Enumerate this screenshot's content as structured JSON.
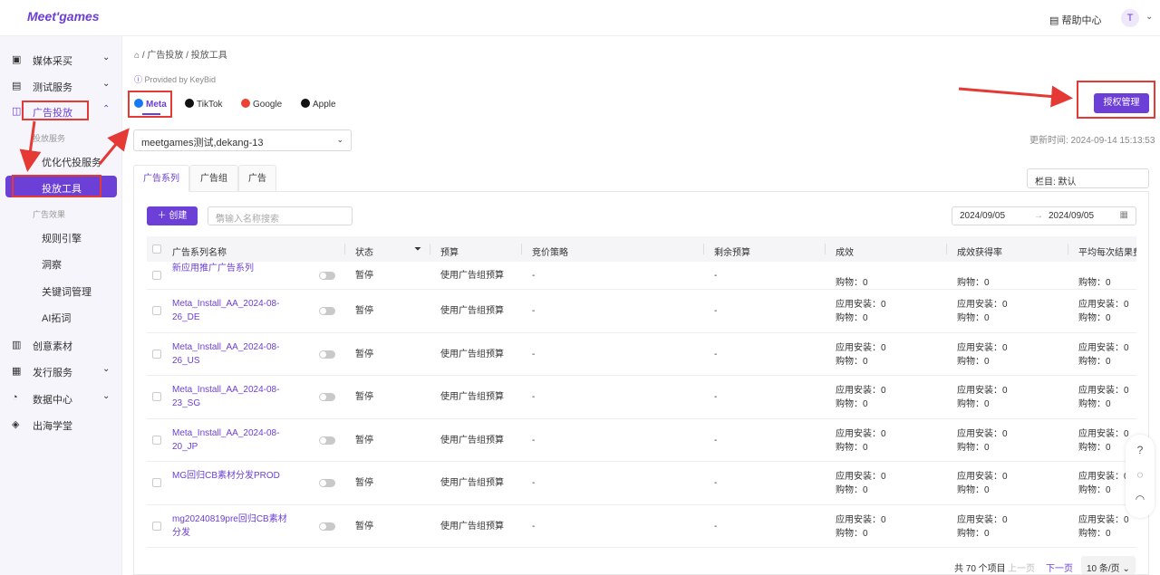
{
  "brand": {
    "logo": "Meet'games"
  },
  "topbar": {
    "help_label": "帮助中心",
    "avatar_letter": "T"
  },
  "sidebar": {
    "items": [
      {
        "label": "媒体采买"
      },
      {
        "label": "测试服务"
      },
      {
        "label": "广告投放"
      },
      {
        "label": "创意素材"
      },
      {
        "label": "发行服务"
      },
      {
        "label": "数据中心"
      },
      {
        "label": "出海学堂"
      }
    ],
    "group_delivery": "投放服务",
    "sub_optimize": "优化代投服务",
    "sub_active": "投放工具",
    "group_effect": "广告效果",
    "sub_rules": "规则引擎",
    "sub_insight": "洞察",
    "sub_keywords": "关键词管理",
    "sub_ai": "AI拓词"
  },
  "breadcrumb": "⌂ / 广告投放 / 投放工具",
  "provided_by": "Provided by KeyBid",
  "platform_tabs": [
    "Meta",
    "TikTok",
    "Google",
    "Apple"
  ],
  "auth_button": "授权管理",
  "account_select": "meetgames测试,dekang-13",
  "last_updated": "更新时间: 2024-09-14 15:13:53",
  "level_tabs": [
    "广告系列",
    "广告组",
    "广告"
  ],
  "columns_select": "栏目: 默认",
  "create_button": "创建",
  "search_placeholder": "请输入名称搜索",
  "date_start": "2024/09/05",
  "date_sep": "→",
  "date_end": "2024/09/05",
  "table": {
    "headers": [
      "广告系列名称",
      "状态",
      "预算",
      "竞价策略",
      "剩余预算",
      "成效",
      "成效获得率",
      "平均每次结果费"
    ],
    "rows": [
      {
        "name": "新应用推广广告系列",
        "status": "暂停",
        "budget": "使用广告组预算",
        "bid": "-",
        "remaining": "-",
        "r1": "",
        "r2": "购物：0"
      },
      {
        "name": "Meta_Install_AA_2024-08-26_DE",
        "status": "暂停",
        "budget": "使用广告组预算",
        "bid": "-",
        "remaining": "-",
        "r1": "应用安装：0",
        "r2": "购物：0"
      },
      {
        "name": "Meta_Install_AA_2024-08-26_US",
        "status": "暂停",
        "budget": "使用广告组预算",
        "bid": "-",
        "remaining": "-",
        "r1": "应用安装：0",
        "r2": "购物：0"
      },
      {
        "name": "Meta_Install_AA_2024-08-23_SG",
        "status": "暂停",
        "budget": "使用广告组预算",
        "bid": "-",
        "remaining": "-",
        "r1": "应用安装：0",
        "r2": "购物：0"
      },
      {
        "name": "Meta_Install_AA_2024-08-20_JP",
        "status": "暂停",
        "budget": "使用广告组预算",
        "bid": "-",
        "remaining": "-",
        "r1": "应用安装：0",
        "r2": "购物：0"
      },
      {
        "name": "MG回归CB素材分发PROD",
        "status": "暂停",
        "budget": "使用广告组预算",
        "bid": "-",
        "remaining": "-",
        "r1": "应用安装：0",
        "r2": "购物：0"
      },
      {
        "name": "mg20240819pre回归CB素材分发",
        "status": "暂停",
        "budget": "使用广告组预算",
        "bid": "-",
        "remaining": "-",
        "r1": "应用安装：0",
        "r2": "购物：0"
      }
    ]
  },
  "pagination": {
    "total": "共 70 个项目",
    "prev": "上一页",
    "next": "下一页",
    "page_size": "10 条/页"
  },
  "colors": {
    "accent": "#6c3fd6",
    "annotation": "#e53935"
  }
}
